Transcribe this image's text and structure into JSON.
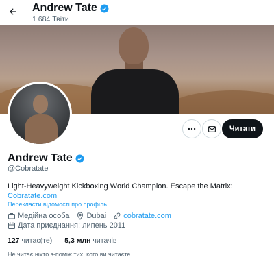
{
  "header": {
    "name": "Andrew Tate",
    "post_count": "1 684 Твіти"
  },
  "profile": {
    "name": "Andrew Tate",
    "handle": "@Cobratate",
    "bio": "Light-Heavyweight Kickboxing World Champion. Escape the Matrix:",
    "bio_link": "Cobratate.com",
    "translate_label": "Перекласти відомості про профіль",
    "category": "Медійна особа",
    "location": "Dubai",
    "website": "cobratate.com",
    "joined": "Дата приєднання: липень 2011"
  },
  "actions": {
    "follow_label": "Читати"
  },
  "stats": {
    "following_count": "127",
    "following_label": "читає(те)",
    "followers_count": "5,3 млн",
    "followers_label": "читачів"
  },
  "followed_by_note": "Не читає ніхто з-поміж тих, кого ви читаєте",
  "colors": {
    "accent": "#1d9bf0",
    "text": "#0f1419",
    "muted": "#536471"
  },
  "icons": [
    "back-arrow-icon",
    "verified-badge-icon",
    "more-icon",
    "mail-icon",
    "briefcase-icon",
    "location-icon",
    "link-icon",
    "calendar-icon"
  ]
}
